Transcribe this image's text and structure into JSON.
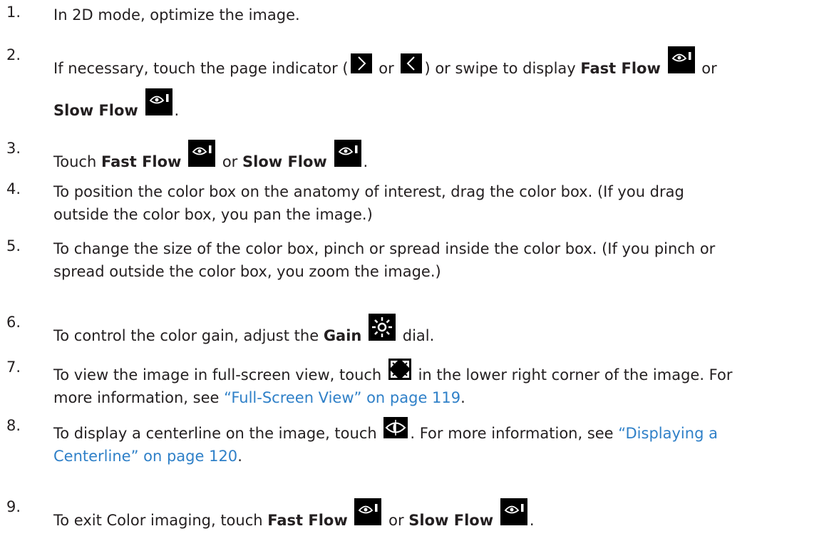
{
  "steps": [
    {
      "num": "1.",
      "text": "In 2D mode, optimize the image."
    },
    {
      "num": "2.",
      "l1_a": "If necessary, touch the page indicator (",
      "l1_b": " or ",
      "l1_c": ") or swipe to display ",
      "l1_bold": "Fast Flow",
      "l1_d": " or",
      "l2_bold": "Slow Flow",
      "l2_end": "."
    },
    {
      "num": "3.",
      "a": "Touch ",
      "bold1": "Fast Flow",
      "b": " or ",
      "bold2": "Slow Flow",
      "c": "."
    },
    {
      "num": "4.",
      "line1": "To position the color box on the anatomy of interest, drag the color box. (If you drag",
      "line2": "outside the color box, you pan the image.)"
    },
    {
      "num": "5.",
      "line1": "To change the size of the color box, pinch or spread inside the color box. (If you pinch or",
      "line2": "spread outside the color box, you zoom the image.)"
    },
    {
      "num": "6.",
      "a": "To control the color gain, adjust the ",
      "bold": "Gain",
      "b": " dial."
    },
    {
      "num": "7.",
      "a": "To view the image in full-screen view, touch ",
      "b": " in the lower right corner of the image. For",
      "c": "more information, see ",
      "link": "“Full-Screen View” on page 119",
      "d": "."
    },
    {
      "num": "8.",
      "a": "To display a centerline on the image, touch ",
      "b": ". For more information, see ",
      "link1": "“Displaying a",
      "link2": "Centerline” on page 120",
      "d": "."
    },
    {
      "num": "9.",
      "a": "To exit Color imaging, touch ",
      "bold1": "Fast Flow",
      "b": " or ",
      "bold2": "Slow Flow",
      "c": "."
    }
  ],
  "colors": {
    "text": "#231f20",
    "link": "#2f80c8",
    "icon_bg": "#000000"
  },
  "icons": [
    "fast-flow-icon",
    "slow-flow-icon",
    "page-next-icon",
    "page-prev-icon",
    "gain-icon",
    "full-screen-icon",
    "centerline-icon"
  ]
}
